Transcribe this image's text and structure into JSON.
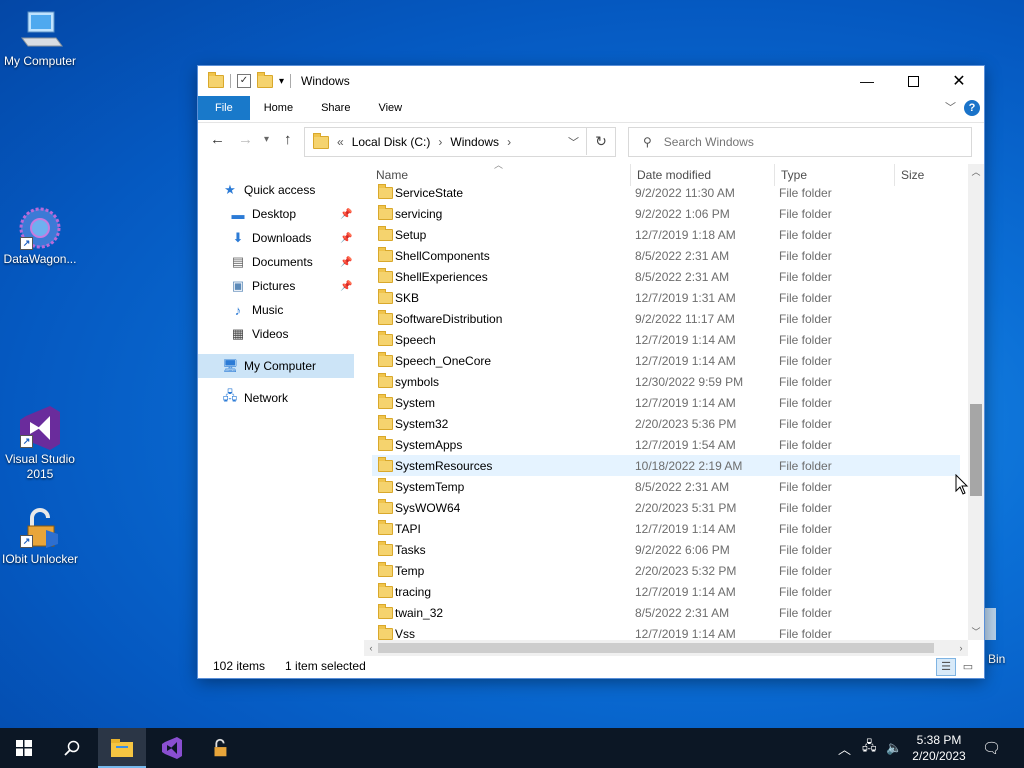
{
  "desktop": {
    "icons": [
      {
        "label": "My Computer"
      },
      {
        "label": "DataWagon..."
      },
      {
        "label": "Visual Studio 2015"
      },
      {
        "label": "IObit Unlocker"
      },
      {
        "label": "Bin"
      }
    ]
  },
  "window": {
    "title": "Windows",
    "ribbon_tabs": [
      "File",
      "Home",
      "Share",
      "View"
    ],
    "breadcrumb": [
      "Local Disk (C:)",
      "Windows"
    ],
    "search_placeholder": "Search Windows",
    "nav": [
      {
        "label": "Quick access",
        "icon": "star-icon"
      },
      {
        "label": "Desktop",
        "icon": "desktop-icon",
        "pinned": true
      },
      {
        "label": "Downloads",
        "icon": "download-icon",
        "pinned": true
      },
      {
        "label": "Documents",
        "icon": "document-icon",
        "pinned": true
      },
      {
        "label": "Pictures",
        "icon": "picture-icon",
        "pinned": true
      },
      {
        "label": "Music",
        "icon": "music-icon"
      },
      {
        "label": "Videos",
        "icon": "video-icon"
      },
      {
        "label": "My Computer",
        "icon": "computer-icon",
        "selected": true
      },
      {
        "label": "Network",
        "icon": "network-icon"
      }
    ],
    "columns": [
      "Name",
      "Date modified",
      "Type",
      "Size"
    ],
    "rows": [
      {
        "name": "ServiceState",
        "date": "9/2/2022 11:30 AM",
        "type": "File folder"
      },
      {
        "name": "servicing",
        "date": "9/2/2022 1:06 PM",
        "type": "File folder"
      },
      {
        "name": "Setup",
        "date": "12/7/2019 1:18 AM",
        "type": "File folder"
      },
      {
        "name": "ShellComponents",
        "date": "8/5/2022 2:31 AM",
        "type": "File folder"
      },
      {
        "name": "ShellExperiences",
        "date": "8/5/2022 2:31 AM",
        "type": "File folder"
      },
      {
        "name": "SKB",
        "date": "12/7/2019 1:31 AM",
        "type": "File folder"
      },
      {
        "name": "SoftwareDistribution",
        "date": "9/2/2022 11:17 AM",
        "type": "File folder"
      },
      {
        "name": "Speech",
        "date": "12/7/2019 1:14 AM",
        "type": "File folder"
      },
      {
        "name": "Speech_OneCore",
        "date": "12/7/2019 1:14 AM",
        "type": "File folder"
      },
      {
        "name": "symbols",
        "date": "12/30/2022 9:59 PM",
        "type": "File folder"
      },
      {
        "name": "System",
        "date": "12/7/2019 1:14 AM",
        "type": "File folder"
      },
      {
        "name": "System32",
        "date": "2/20/2023 5:36 PM",
        "type": "File folder"
      },
      {
        "name": "SystemApps",
        "date": "12/7/2019 1:54 AM",
        "type": "File folder"
      },
      {
        "name": "SystemResources",
        "date": "10/18/2022 2:19 AM",
        "type": "File folder",
        "selected": true
      },
      {
        "name": "SystemTemp",
        "date": "8/5/2022 2:31 AM",
        "type": "File folder"
      },
      {
        "name": "SysWOW64",
        "date": "2/20/2023 5:31 PM",
        "type": "File folder"
      },
      {
        "name": "TAPI",
        "date": "12/7/2019 1:14 AM",
        "type": "File folder"
      },
      {
        "name": "Tasks",
        "date": "9/2/2022 6:06 PM",
        "type": "File folder"
      },
      {
        "name": "Temp",
        "date": "2/20/2023 5:32 PM",
        "type": "File folder"
      },
      {
        "name": "tracing",
        "date": "12/7/2019 1:14 AM",
        "type": "File folder"
      },
      {
        "name": "twain_32",
        "date": "8/5/2022 2:31 AM",
        "type": "File folder"
      },
      {
        "name": "Vss",
        "date": "12/7/2019 1:14 AM",
        "type": "File folder"
      }
    ],
    "status": {
      "items": "102 items",
      "selected": "1 item selected"
    }
  },
  "taskbar": {
    "time": "5:38 PM",
    "date": "2/20/2023"
  },
  "colors": {
    "accent": "#1979ca",
    "selection": "#cce4f7",
    "taskbar": "#0c1725"
  }
}
